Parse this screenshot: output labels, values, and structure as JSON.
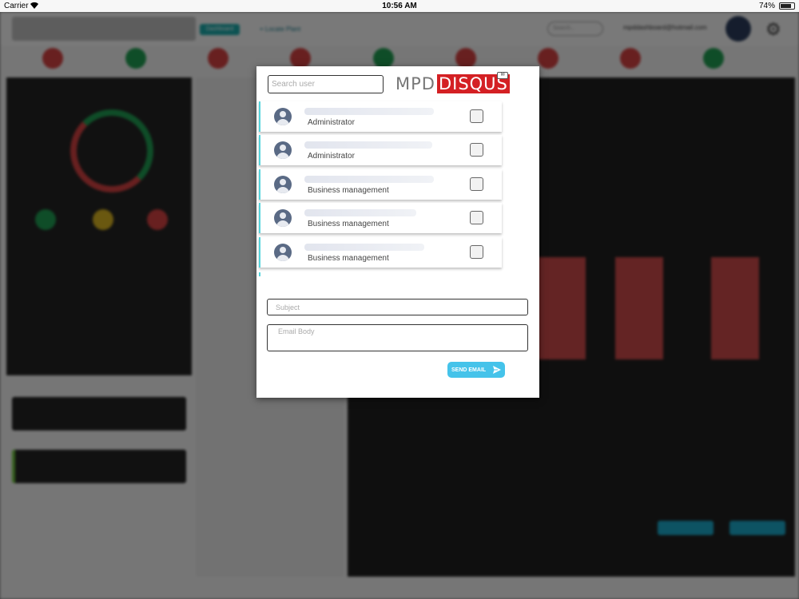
{
  "status_bar": {
    "carrier": "Carrier",
    "time": "10:56 AM",
    "battery": "74%"
  },
  "background_app": {
    "dashboard_tab": "Dashboard",
    "locate_plant": "Locate Plant",
    "search_placeholder": "Search...",
    "user_email": "mpddashboard@hotmail.com"
  },
  "modal": {
    "search_placeholder": "Search user",
    "brand": {
      "mpd": "MPD",
      "disqus": "DISQUS"
    },
    "users": [
      {
        "role": "Administrator"
      },
      {
        "role": "Administrator"
      },
      {
        "role": "Business management"
      },
      {
        "role": "Business management"
      },
      {
        "role": "Business management"
      }
    ],
    "subject_placeholder": "Subject",
    "body_placeholder": "Email Body",
    "send_label": "SEND EMAIL"
  },
  "colors": {
    "accent": "#45c3ea",
    "brand_red": "#d42024",
    "row_border": "#55d4dc"
  }
}
